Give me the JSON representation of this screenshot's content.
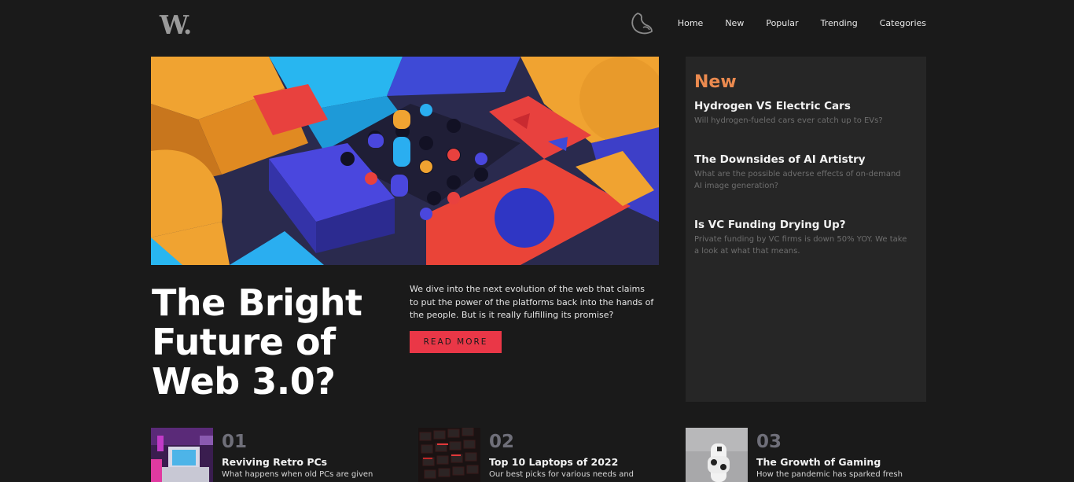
{
  "header": {
    "logo_text": "W",
    "logo_dot": ".",
    "theme_icon": "moon-icon",
    "nav": [
      "Home",
      "New",
      "Popular",
      "Trending",
      "Categories"
    ]
  },
  "hero": {
    "title": "The Bright Future of Web 3.0?",
    "description": "We dive into the next evolution of the web that claims to put the power of the platforms back into the hands of the people. But is it really fulfilling its promise?",
    "button_label": "READ MORE"
  },
  "sidebar": {
    "heading": "New",
    "items": [
      {
        "title": "Hydrogen VS Electric Cars",
        "description": "Will hydrogen-fueled cars ever catch up to EVs?"
      },
      {
        "title": "The Downsides of AI Artistry",
        "description": "What are the possible adverse effects of on-demand AI image generation?"
      },
      {
        "title": "Is VC Funding Drying Up?",
        "description": "Private funding by VC firms is down 50% YOY. We take a look at what that means."
      }
    ]
  },
  "articles": [
    {
      "number": "01",
      "title": "Reviving Retro PCs",
      "description": "What happens when old PCs are given"
    },
    {
      "number": "02",
      "title": "Top 10 Laptops of 2022",
      "description": "Our best picks for various needs and"
    },
    {
      "number": "03",
      "title": "The Growth of Gaming",
      "description": "How the pandemic has sparked fresh"
    }
  ],
  "colors": {
    "background": "#1a1a1a",
    "accent_red": "#ea3747",
    "accent_orange": "#eb8a4f",
    "sidebar_bg": "#262626",
    "muted_number": "#6f6f79"
  }
}
